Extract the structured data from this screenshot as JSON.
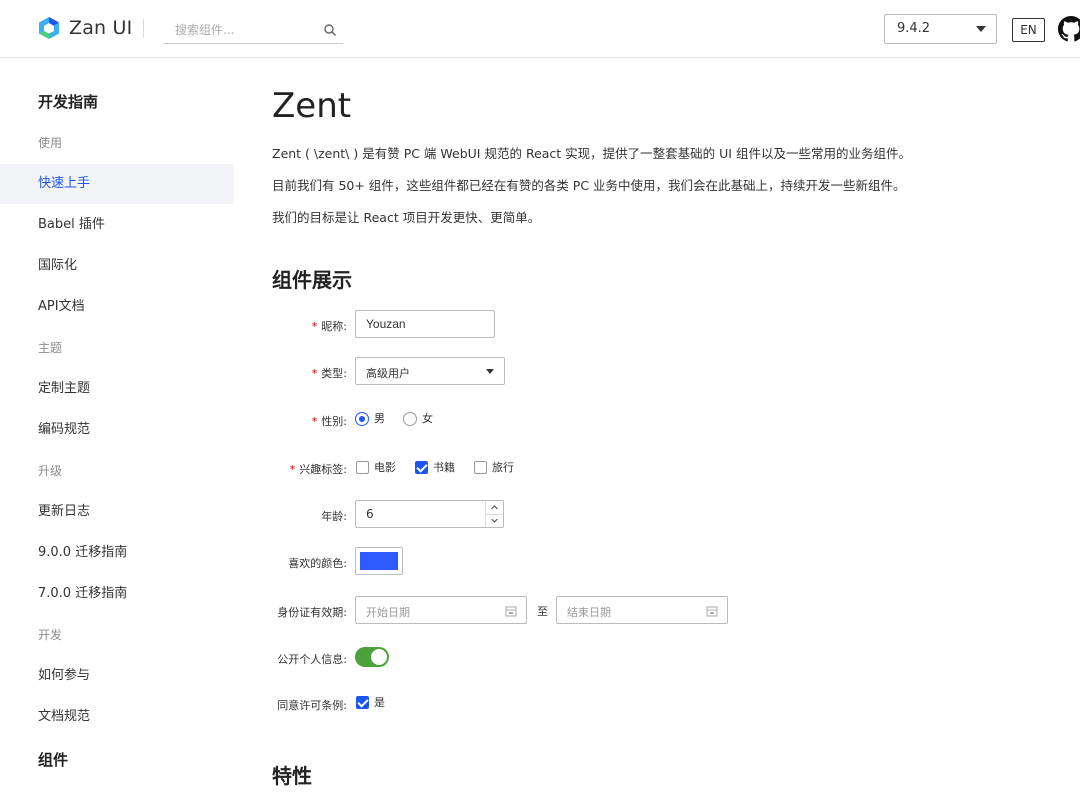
{
  "header": {
    "brand": "Zan UI",
    "search_placeholder": "搜索组件...",
    "version": "9.4.2",
    "lang": "EN"
  },
  "sidebar": {
    "items": [
      {
        "label": "开发指南",
        "kind": "title"
      },
      {
        "label": "使用",
        "kind": "group"
      },
      {
        "label": "快速上手",
        "kind": "item",
        "active": true
      },
      {
        "label": "Babel 插件",
        "kind": "item"
      },
      {
        "label": "国际化",
        "kind": "item"
      },
      {
        "label": "API文档",
        "kind": "item"
      },
      {
        "label": "主题",
        "kind": "group"
      },
      {
        "label": "定制主题",
        "kind": "item"
      },
      {
        "label": "编码规范",
        "kind": "item"
      },
      {
        "label": "升级",
        "kind": "group"
      },
      {
        "label": "更新日志",
        "kind": "item"
      },
      {
        "label": "9.0.0 迁移指南",
        "kind": "item"
      },
      {
        "label": "7.0.0 迁移指南",
        "kind": "item"
      },
      {
        "label": "开发",
        "kind": "group"
      },
      {
        "label": "如何参与",
        "kind": "item"
      },
      {
        "label": "文档规范",
        "kind": "item"
      },
      {
        "label": "组件",
        "kind": "title"
      }
    ]
  },
  "main": {
    "title": "Zent",
    "paragraphs": [
      "Zent ( \\zent\\ ) 是有赞 PC 端 WebUI 规范的 React 实现，提供了一整套基础的 UI 组件以及一些常用的业务组件。",
      "目前我们有 50+ 组件，这些组件都已经在有赞的各类 PC 业务中使用，我们会在此基础上，持续开发一些新组件。",
      "我们的目标是让 React 项目开发更快、更简单。"
    ],
    "section_demo": "组件展示",
    "section_features": "特性",
    "form": {
      "nickname_label": "昵称:",
      "nickname_value": "Youzan",
      "type_label": "类型:",
      "type_value": "高级用户",
      "gender_label": "性别:",
      "gender_options": [
        "男",
        "女"
      ],
      "gender_selected": "男",
      "tags_label": "兴趣标签:",
      "tag_options": [
        "电影",
        "书籍",
        "旅行"
      ],
      "tags_checked": [
        "书籍"
      ],
      "age_label": "年龄:",
      "age_value": "6",
      "color_label": "喜欢的颜色:",
      "color_value": "#2e5bff",
      "idcard_label": "身份证有效期:",
      "start_placeholder": "开始日期",
      "to_label": "至",
      "end_placeholder": "结束日期",
      "public_label": "公开个人信息:",
      "public_on": true,
      "agree_label": "同意许可条例:",
      "agree_option": "是",
      "agree_checked": true
    }
  },
  "colors": {
    "accent": "#1c55f0",
    "required": "#d40000",
    "switch_on": "#4ba13a"
  }
}
